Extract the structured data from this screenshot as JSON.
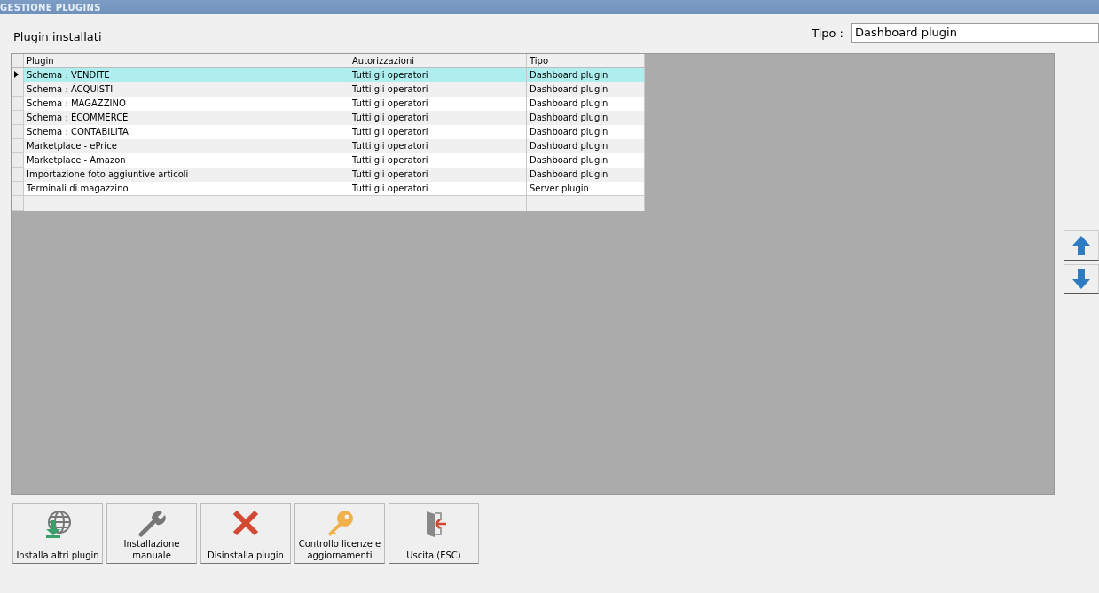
{
  "window": {
    "title": "GESTIONE PLUGINS"
  },
  "section_title": "Plugin installati",
  "type_filter": {
    "label": "Tipo :",
    "value": "Dashboard plugin"
  },
  "table": {
    "columns": [
      "Plugin",
      "Autorizzazioni",
      "Tipo"
    ],
    "rows": [
      {
        "cells": [
          "Schema : VENDITE",
          "Tutti gli operatori",
          "Dashboard plugin"
        ],
        "selected": true
      },
      {
        "cells": [
          "Schema : ACQUISTI",
          "Tutti gli operatori",
          "Dashboard plugin"
        ],
        "selected": false
      },
      {
        "cells": [
          "Schema : MAGAZZINO",
          "Tutti gli operatori",
          "Dashboard plugin"
        ],
        "selected": false
      },
      {
        "cells": [
          "Schema : ECOMMERCE",
          "Tutti gli operatori",
          "Dashboard plugin"
        ],
        "selected": false
      },
      {
        "cells": [
          "Schema : CONTABILITA'",
          "Tutti gli operatori",
          "Dashboard plugin"
        ],
        "selected": false
      },
      {
        "cells": [
          "Marketplace - ePrice",
          "Tutti gli operatori",
          "Dashboard plugin"
        ],
        "selected": false
      },
      {
        "cells": [
          "Marketplace - Amazon",
          "Tutti gli operatori",
          "Dashboard plugin"
        ],
        "selected": false
      },
      {
        "cells": [
          "Importazione foto aggiuntive articoli",
          "Tutti gli operatori",
          "Dashboard plugin"
        ],
        "selected": false
      },
      {
        "cells": [
          "Terminali di magazzino",
          "Tutti gli operatori",
          "Server plugin"
        ],
        "selected": false
      }
    ]
  },
  "side_buttons": [
    {
      "kind": "up"
    },
    {
      "kind": "down"
    }
  ],
  "buttons": [
    {
      "kind": "install",
      "label": "Installa altri plugin"
    },
    {
      "kind": "manual",
      "label": "Installazione manuale"
    },
    {
      "kind": "uninstall",
      "label": "Disinstalla plugin"
    },
    {
      "kind": "license",
      "label": "Controllo licenze e aggiornamenti"
    },
    {
      "kind": "exit",
      "label": "Uscita (ESC)"
    }
  ]
}
